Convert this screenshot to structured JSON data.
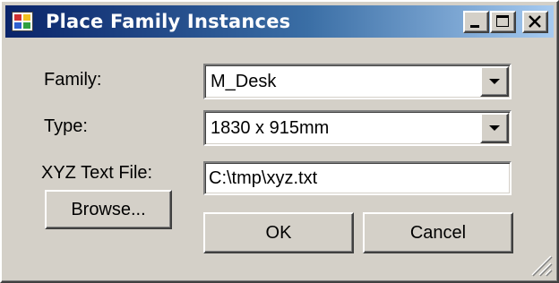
{
  "window": {
    "title": "Place Family Instances",
    "icon": "application-icon",
    "controls": [
      "minimize-icon",
      "maximize-icon",
      "close-icon"
    ]
  },
  "form": {
    "family_label": "Family:",
    "family_value": "M_Desk",
    "type_label": "Type:",
    "type_value": "1830 x 915mm",
    "xyz_label": "XYZ Text File:",
    "xyz_value": "C:\\tmp\\xyz.txt",
    "browse_label": "Browse..."
  },
  "buttons": {
    "ok_label": "OK",
    "cancel_label": "Cancel"
  },
  "colors": {
    "title_start": "#0a246a",
    "title_end": "#a6caf0",
    "face": "#d4d0c8"
  }
}
